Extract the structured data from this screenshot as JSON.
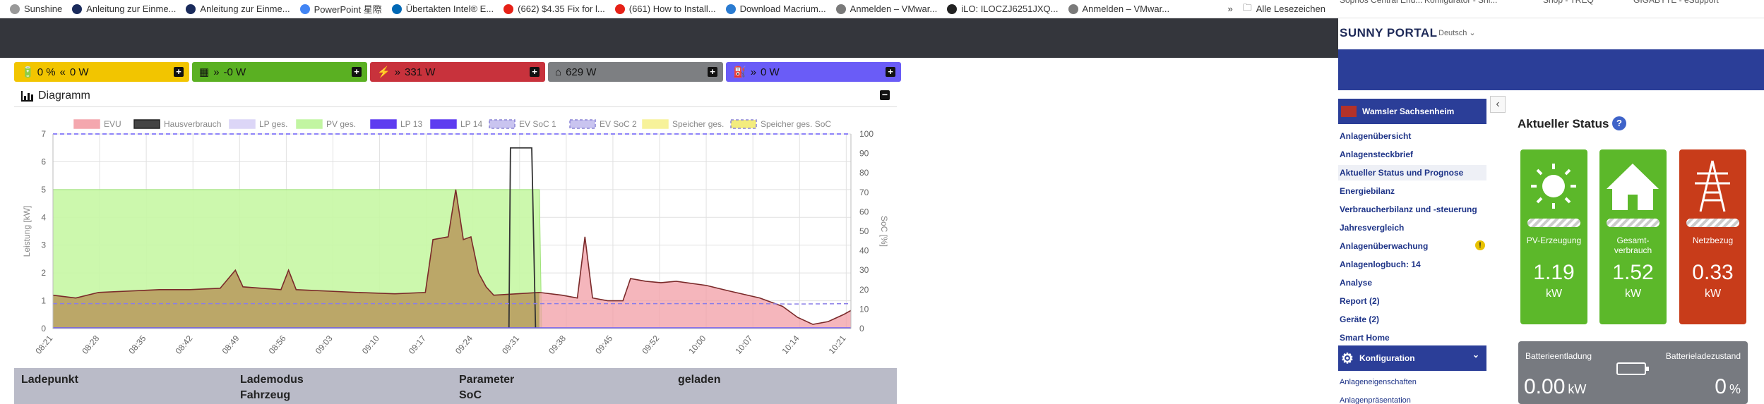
{
  "bookmarks": [
    {
      "label": "Sunshine",
      "icon": "sun-icon",
      "color": "#999999"
    },
    {
      "label": "Anleitung zur Einme...",
      "icon": "globe-icon",
      "color": "#1a2b5c"
    },
    {
      "label": "Anleitung zur Einme...",
      "icon": "globe-icon",
      "color": "#1a2b5c"
    },
    {
      "label": "PowerPoint 星際",
      "icon": "google-icon",
      "color": "#4285f4"
    },
    {
      "label": "Übertakten Intel® E...",
      "icon": "intel-icon",
      "color": "#0068b5"
    },
    {
      "label": "(662) $4.35 Fix for l...",
      "icon": "youtube-icon",
      "color": "#e62117"
    },
    {
      "label": "(661) How to Install...",
      "icon": "youtube-icon",
      "color": "#e62117"
    },
    {
      "label": "Download Macrium...",
      "icon": "macrium-icon",
      "color": "#2a7bd1"
    },
    {
      "label": "Anmelden – VMwar...",
      "icon": "vmware-icon",
      "color": "#7a7a7a"
    },
    {
      "label": "iLO: ILOCZJ6251JXQ...",
      "icon": "ilo-icon",
      "color": "#222222"
    },
    {
      "label": "Anmelden – VMwar...",
      "icon": "vmware-icon",
      "color": "#7a7a7a"
    }
  ],
  "bookmarks_more": "»",
  "all_bookmarks": "Alle Lesezeichen",
  "tiles": [
    {
      "name": "battery",
      "text": "0 %",
      "value": "0 W",
      "color": "#f2c500",
      "fg": "#111111"
    },
    {
      "name": "pv",
      "text": "",
      "value": "-0 W",
      "color": "#5ab022",
      "fg": "#111111"
    },
    {
      "name": "grid",
      "text": "",
      "value": "331 W",
      "color": "#c8323c",
      "fg": "#111111"
    },
    {
      "name": "house",
      "text": "",
      "value": "629 W",
      "color": "#7d7f82",
      "fg": "#111111"
    },
    {
      "name": "chargepoint",
      "text": "",
      "value": "0 W",
      "color": "#6a5cf7",
      "fg": "#111111"
    }
  ],
  "diagram": {
    "title": "Diagramm"
  },
  "chart_data": {
    "type": "area",
    "legend": [
      "EVU",
      "Hausverbrauch",
      "LP ges.",
      "PV ges.",
      "LP 13",
      "LP 14",
      "EV SoC 1",
      "EV SoC 2",
      "Speicher ges.",
      "Speicher ges. SoC"
    ],
    "legend_colors": [
      "#f4a7ae",
      "#444444",
      "#dcd6f7",
      "#c2f5a2",
      "#5e3cf0",
      "#5e3cf0",
      "#c9c4f0",
      "#c9c4f0",
      "#f7f29a",
      "#f3ec7e"
    ],
    "ylabel": "Leistung [kW]",
    "y2label": "SoC [%]",
    "ylim": [
      0,
      7
    ],
    "y2lim": [
      0,
      100
    ],
    "yticks": [
      0,
      1,
      2,
      3,
      4,
      5,
      6,
      7
    ],
    "y2ticks": [
      0,
      10,
      20,
      30,
      40,
      50,
      60,
      70,
      80,
      90,
      100
    ],
    "xticks": [
      "08:21",
      "08:28",
      "08:35",
      "08:42",
      "08:49",
      "08:56",
      "09:03",
      "09:10",
      "09:17",
      "09:24",
      "09:31",
      "09:38",
      "09:45",
      "09:52",
      "10:00",
      "10:07",
      "10:14",
      "10:21"
    ],
    "grid": true,
    "legend_position": "top",
    "series": [
      {
        "name": "PV ges.",
        "values": [
          [
            0,
            5.0
          ],
          [
            64,
            5.0
          ],
          [
            64.3,
            0
          ]
        ]
      },
      {
        "name": "EVU",
        "values": [
          [
            0,
            1.2
          ],
          [
            3,
            1.1
          ],
          [
            6,
            1.3
          ],
          [
            10,
            1.35
          ],
          [
            14,
            1.4
          ],
          [
            18,
            1.4
          ],
          [
            22,
            1.45
          ],
          [
            24,
            2.1
          ],
          [
            25,
            1.5
          ],
          [
            30,
            1.4
          ],
          [
            31,
            2.1
          ],
          [
            32,
            1.4
          ],
          [
            40,
            1.3
          ],
          [
            45,
            1.25
          ],
          [
            49,
            1.3
          ],
          [
            50,
            3.2
          ],
          [
            52,
            3.3
          ],
          [
            53,
            5.0
          ],
          [
            54,
            3.2
          ],
          [
            55,
            3.3
          ],
          [
            56,
            2.0
          ],
          [
            57,
            1.5
          ],
          [
            58,
            1.2
          ],
          [
            64,
            1.3
          ],
          [
            67,
            1.2
          ],
          [
            69,
            1.1
          ],
          [
            70,
            3.3
          ],
          [
            71,
            1.1
          ],
          [
            73,
            1.0
          ],
          [
            75,
            1.0
          ],
          [
            76,
            1.8
          ],
          [
            78,
            1.7
          ],
          [
            80,
            1.65
          ],
          [
            82,
            1.7
          ],
          [
            86,
            1.55
          ],
          [
            89,
            1.35
          ],
          [
            93,
            1.1
          ],
          [
            96,
            0.8
          ],
          [
            98,
            0.4
          ],
          [
            100,
            0.15
          ],
          [
            102,
            0.25
          ],
          [
            104,
            0.5
          ],
          [
            105,
            0.65
          ]
        ]
      },
      {
        "name": "Hausverbrauch",
        "values": [
          [
            60,
            0
          ],
          [
            60.2,
            6.5
          ],
          [
            63,
            6.5
          ],
          [
            63.5,
            0
          ]
        ]
      },
      {
        "name": "Speicher ges. SoC",
        "values": [
          [
            0,
            0
          ]
        ]
      },
      {
        "name": "EV SoC 1",
        "values": [
          [
            0,
            100
          ],
          [
            105,
            100
          ]
        ]
      },
      {
        "name": "EV SoC 2",
        "values": [
          [
            0,
            12.8
          ],
          [
            93,
            12.8
          ],
          [
            97,
            12.6
          ],
          [
            105,
            12.8
          ]
        ]
      }
    ]
  },
  "ladetable": {
    "col1": "Ladepunkt",
    "col2a": "Lademodus",
    "col2b": "Fahrzeug",
    "col3a": "Parameter",
    "col3b": "SoC",
    "col4": "geladen"
  },
  "sunny": {
    "top_items": [
      "Sophos Central End...",
      "Konfigurator - Shi...",
      "Shop - TREQ",
      "GIGABYTE - eSupport"
    ],
    "logo": "SUNNY PORTAL",
    "language": "Deutsch",
    "plant": "Wamsler Sachsenheim",
    "nav": [
      "Anlagenübersicht",
      "Anlagensteckbrief",
      "Aktueller Status und Prognose",
      "Energiebilanz",
      "Verbraucherbilanz und -steuerung",
      "Jahresvergleich",
      "Anlagenüberwachung",
      "Anlagenlogbuch: 14",
      "Analyse",
      "Report (2)",
      "Geräte (2)",
      "Smart Home"
    ],
    "config": "Konfiguration",
    "sub": [
      "Anlageneigenschaften",
      "Anlagenpräsentation"
    ],
    "status_title": "Aktueller Status",
    "cards": [
      {
        "label": "PV-Erzeugung",
        "value": "1.19",
        "unit": "kW",
        "color": "#5cb82a"
      },
      {
        "label": "Gesamt-\nverbrauch",
        "value": "1.52",
        "unit": "kW",
        "color": "#5cb82a"
      },
      {
        "label": "Netzbezug",
        "value": "0.33",
        "unit": "kW",
        "color": "#c83c1a"
      }
    ],
    "battery": {
      "label1": "Batterieentladung",
      "label2": "Batterieladezustand",
      "value1": "0.00",
      "unit1": "kW",
      "value2": "0",
      "unit2": "%"
    }
  }
}
